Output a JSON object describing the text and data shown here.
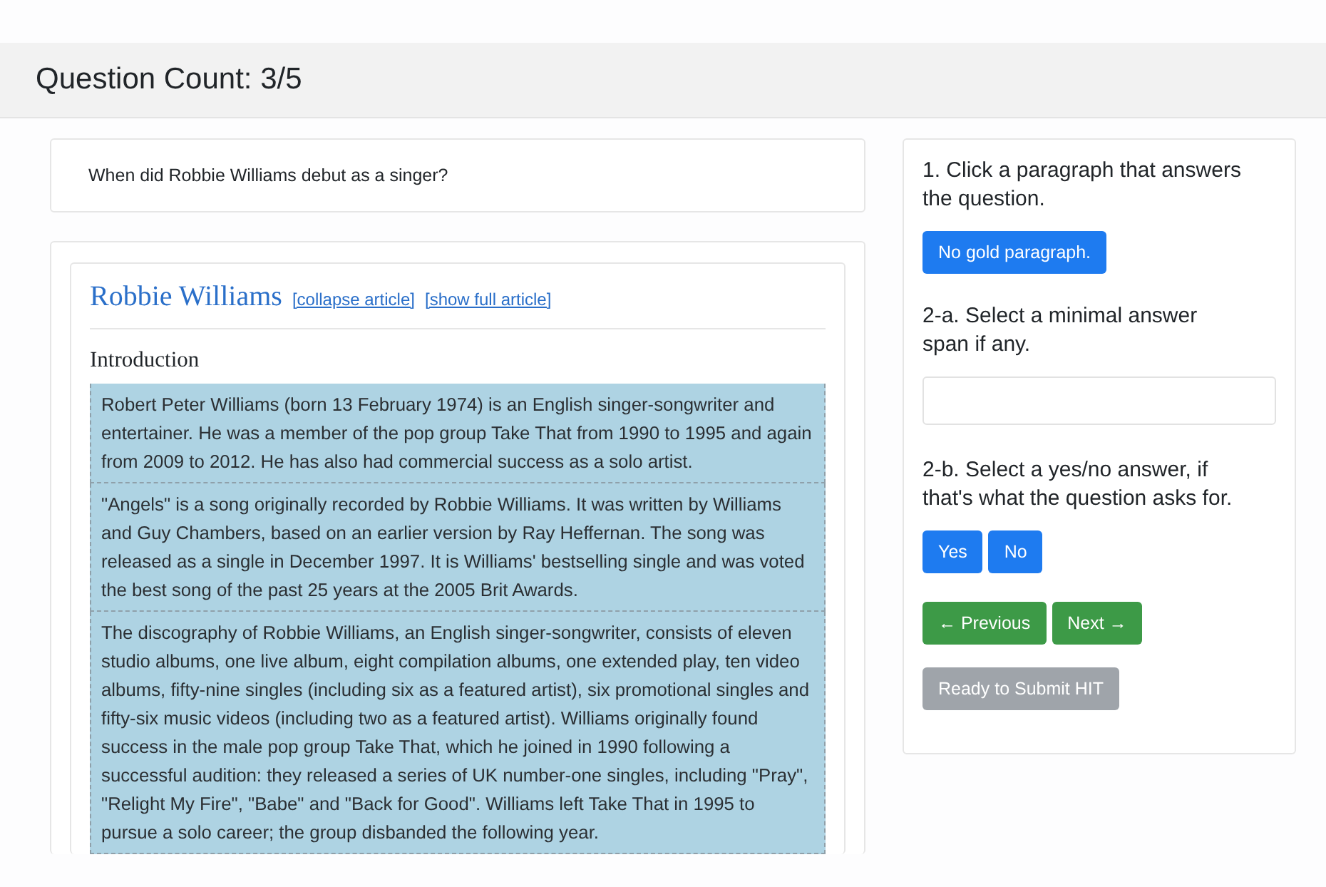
{
  "header": {
    "title": "Question Count: 3/5"
  },
  "question": "When did Robbie Williams debut as a singer?",
  "article": {
    "title": "Robbie Williams",
    "links": [
      "[collapse article]",
      "[show full article]"
    ],
    "section": "Introduction",
    "paragraphs": [
      "Robert Peter Williams (born 13 February 1974) is an English singer-songwriter and entertainer. He was a member of the pop group Take That from 1990 to 1995 and again from 2009 to 2012. He has also had commercial success as a solo artist.",
      "\"Angels\" is a song originally recorded by Robbie Williams. It was written by Williams and Guy Chambers, based on an earlier version by Ray Heffernan. The song was released as a single in December 1997. It is Williams' bestselling single and was voted the best song of the past 25 years at the 2005 Brit Awards.",
      "The discography of Robbie Williams, an English singer-songwriter, consists of eleven studio albums, one live album, eight compilation albums, one extended play, ten video albums, fifty-nine singles (including six as a featured artist), six promotional singles and fifty-six music videos (including two as a featured artist). Williams originally found success in the male pop group Take That, which he joined in 1990 following a successful audition: they released a series of UK number-one singles, including \"Pray\", \"Relight My Fire\", \"Babe\" and \"Back for Good\". Williams left Take That in 1995 to pursue a solo career; the group disbanded the following year."
    ]
  },
  "panel": {
    "step1": "1. Click a paragraph that answers the question.",
    "no_gold_button": {
      "label": "No gold paragraph.",
      "kind": "primary",
      "disabled": false
    },
    "step2a": "2-a. Select a minimal answer span if any.",
    "step2b": "2-b. Select a yes/no answer, if that's what the question asks for.",
    "yes_no_buttons": [
      {
        "label": "Yes",
        "kind": "primary",
        "disabled": false
      },
      {
        "label": "No",
        "kind": "primary",
        "disabled": false
      }
    ],
    "nav_buttons": [
      {
        "label": "← Previous",
        "kind": "success",
        "disabled": false
      },
      {
        "label": "Next →",
        "kind": "success",
        "disabled": false
      }
    ],
    "submit_button": {
      "label": "Ready to Submit HIT",
      "kind": "secondary",
      "disabled": true
    }
  }
}
